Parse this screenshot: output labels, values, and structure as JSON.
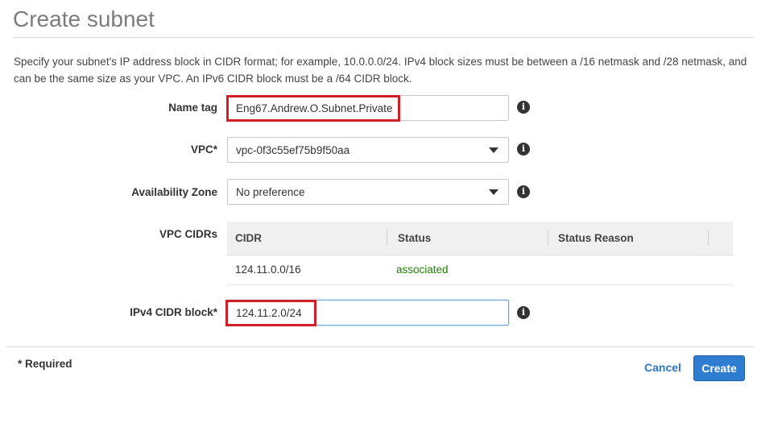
{
  "page": {
    "title": "Create subnet",
    "description": "Specify your subnet's IP address block in CIDR format; for example, 10.0.0.0/24. IPv4 block sizes must be between a /16 netmask and /28 netmask, and can be the same size as your VPC. An IPv6 CIDR block must be a /64 CIDR block."
  },
  "form": {
    "name_tag": {
      "label": "Name tag",
      "value": "Eng67.Andrew.O.Subnet.Private"
    },
    "vpc": {
      "label": "VPC*",
      "value": "vpc-0f3c55ef75b9f50aa"
    },
    "availability_zone": {
      "label": "Availability Zone",
      "value": "No preference"
    },
    "vpc_cidrs": {
      "label": "VPC CIDRs",
      "columns": [
        "CIDR",
        "Status",
        "Status Reason"
      ],
      "rows": [
        {
          "cidr": "124.11.0.0/16",
          "status": "associated",
          "status_reason": ""
        }
      ]
    },
    "ipv4_cidr": {
      "label": "IPv4 CIDR block*",
      "value": "124.11.2.0/24"
    }
  },
  "footer": {
    "required_note": "* Required",
    "cancel_label": "Cancel",
    "create_label": "Create"
  },
  "colors": {
    "status_associated": "#1d8102",
    "primary_button": "#2f7dd1",
    "link": "#2c76c8",
    "highlight": "#d11f2a"
  },
  "icons": {
    "info": "info-circle-icon",
    "dropdown": "caret-down-icon"
  }
}
